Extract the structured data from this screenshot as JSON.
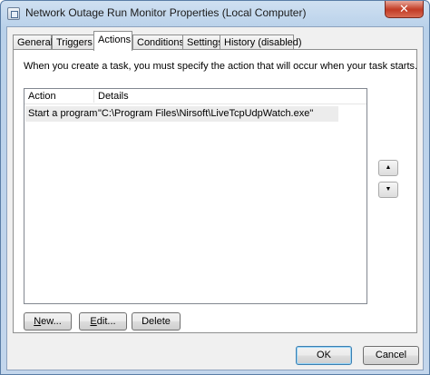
{
  "window": {
    "title": "Network Outage Run Monitor Properties (Local Computer)",
    "close_label": "✕"
  },
  "tabs": [
    {
      "label": "General"
    },
    {
      "label": "Triggers"
    },
    {
      "label": "Actions",
      "active": true
    },
    {
      "label": "Conditions"
    },
    {
      "label": "Settings"
    },
    {
      "label": "History (disabled)"
    }
  ],
  "actions_tab": {
    "intro": "When you create a task, you must specify the action that will occur when your task starts.",
    "columns": [
      "Action",
      "Details"
    ],
    "rows": [
      {
        "action": "Start a program",
        "details": "\"C:\\Program Files\\Nirsoft\\LiveTcpUdpWatch.exe\""
      }
    ],
    "move_up_glyph": "▲",
    "move_down_glyph": "▼",
    "buttons": {
      "new": {
        "mnemonic": "N",
        "rest": "ew..."
      },
      "edit": {
        "mnemonic": "E",
        "rest": "dit..."
      },
      "delete": "Delete"
    }
  },
  "footer": {
    "ok": "OK",
    "cancel": "Cancel"
  },
  "colors": {
    "frame": "#b9d1ea",
    "client": "#f0f0f0",
    "close_button": "#c74a34",
    "default_button_border": "#3c7fb1"
  }
}
